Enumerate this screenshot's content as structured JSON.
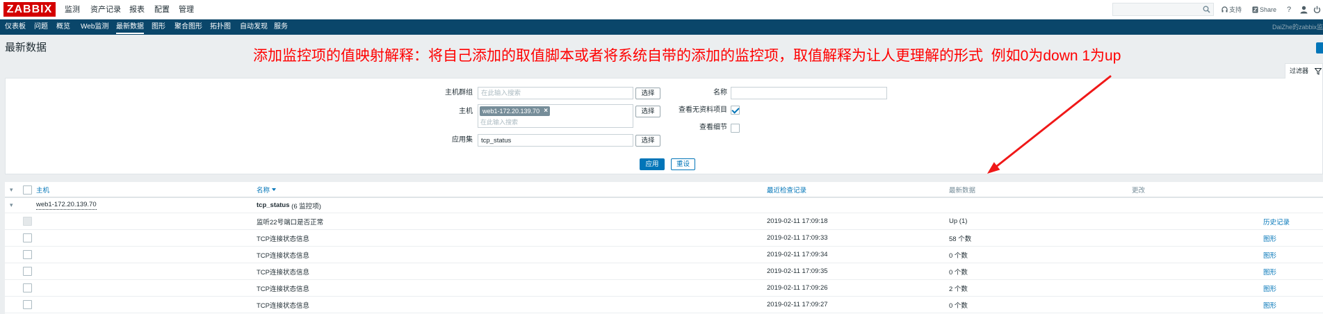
{
  "colors": {
    "logo_red": "#d40000",
    "nav_bar": "#0a466a",
    "link_blue": "#0275b8",
    "annotation_red": "#ff0000"
  },
  "header": {
    "logo": "ZABBIX",
    "main_menu": [
      {
        "label": "监测"
      },
      {
        "label": "资产记录"
      },
      {
        "label": "报表"
      },
      {
        "label": "配置"
      },
      {
        "label": "管理"
      }
    ],
    "search_icon": "search-icon",
    "support": {
      "label": "支持",
      "icon": "headset-icon"
    },
    "share": {
      "label": "Share",
      "icon": "share-icon"
    },
    "help": {
      "label": "?"
    },
    "user_icon": "user-icon",
    "logout_icon": "power-icon"
  },
  "sub_menu": {
    "items": [
      {
        "label": "仪表板",
        "active": false
      },
      {
        "label": "问题",
        "active": false
      },
      {
        "label": "概览",
        "active": false
      },
      {
        "label": "Web监测",
        "active": false
      },
      {
        "label": "最新数据",
        "active": true
      },
      {
        "label": "图形",
        "active": false
      },
      {
        "label": "聚合图形",
        "active": false
      },
      {
        "label": "拓扑图",
        "active": false
      },
      {
        "label": "自动发现",
        "active": false
      },
      {
        "label": "服务",
        "active": false
      }
    ],
    "server_name": "DaiZhe的zabbix监"
  },
  "page": {
    "title": "最新数据",
    "annotation": "添加监控项的值映射解释：将自己添加的取值脚本或者将系统自带的添加的监控项，取值解释为让人更理解的形式  例如0为down 1为up"
  },
  "filter": {
    "tab_label": "过滤器",
    "tab_icon": "filter-icon",
    "host_groups": {
      "label": "主机群组",
      "placeholder": "在此输入搜索",
      "select_label": "选择"
    },
    "hosts": {
      "label": "主机",
      "selected": [
        "web1-172.20.139.70"
      ],
      "placeholder": "在此输入搜索",
      "select_label": "选择"
    },
    "application": {
      "label": "应用集",
      "value": "tcp_status",
      "select_label": "选择"
    },
    "name": {
      "label": "名称",
      "value": ""
    },
    "show_items_without_data": {
      "label": "查看无资料项目",
      "checked": true
    },
    "show_details": {
      "label": "查看细节",
      "checked": false
    },
    "apply_label": "应用",
    "reset_label": "重设"
  },
  "table": {
    "columns": {
      "host": "主机",
      "name": "名称",
      "last_check": "最近检查记录",
      "last_value": "最新数据",
      "change": "更改"
    },
    "group": {
      "host": "web1-172.20.139.70",
      "application": "tcp_status",
      "item_count": "(6 监控项)"
    },
    "rows": [
      {
        "name": "监听22号端口是否正常",
        "last_check": "2019-02-11 17:09:18",
        "last_value": "Up (1)",
        "action": "历史记录",
        "checkbox_disabled": true
      },
      {
        "name": "TCP连接状态信息",
        "last_check": "2019-02-11 17:09:33",
        "last_value": "58 个数",
        "action": "图形",
        "checkbox_disabled": false
      },
      {
        "name": "TCP连接状态信息",
        "last_check": "2019-02-11 17:09:34",
        "last_value": "0 个数",
        "action": "图形",
        "checkbox_disabled": false
      },
      {
        "name": "TCP连接状态信息",
        "last_check": "2019-02-11 17:09:35",
        "last_value": "0 个数",
        "action": "图形",
        "checkbox_disabled": false
      },
      {
        "name": "TCP连接状态信息",
        "last_check": "2019-02-11 17:09:26",
        "last_value": "2 个数",
        "action": "图形",
        "checkbox_disabled": false
      },
      {
        "name": "TCP连接状态信息",
        "last_check": "2019-02-11 17:09:27",
        "last_value": "0 个数",
        "action": "图形",
        "checkbox_disabled": false
      }
    ]
  }
}
